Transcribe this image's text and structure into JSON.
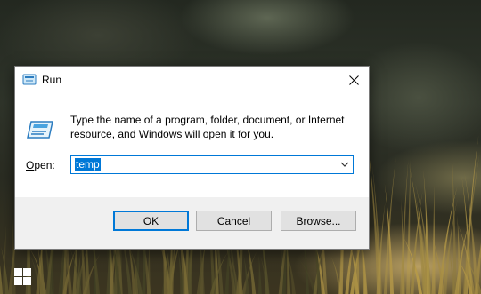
{
  "dialog": {
    "title": "Run",
    "description": "Type the name of a program, folder, document, or Internet resource, and Windows will open it for you.",
    "open_label_accel": "O",
    "open_label_rest": "pen:",
    "open_value": "temp",
    "buttons": {
      "ok_label": "OK",
      "cancel_label": "Cancel",
      "browse_accel": "B",
      "browse_rest": "rowse..."
    }
  },
  "icons": {
    "title_icon": "run-icon",
    "content_icon": "run-icon",
    "close": "close-icon",
    "dropdown": "chevron-down-icon",
    "taskbar": "windows-logo-icon"
  },
  "colors": {
    "accent": "#0078d7",
    "dialog_bg": "#f0f0f0",
    "button_bg": "#e1e1e1"
  }
}
